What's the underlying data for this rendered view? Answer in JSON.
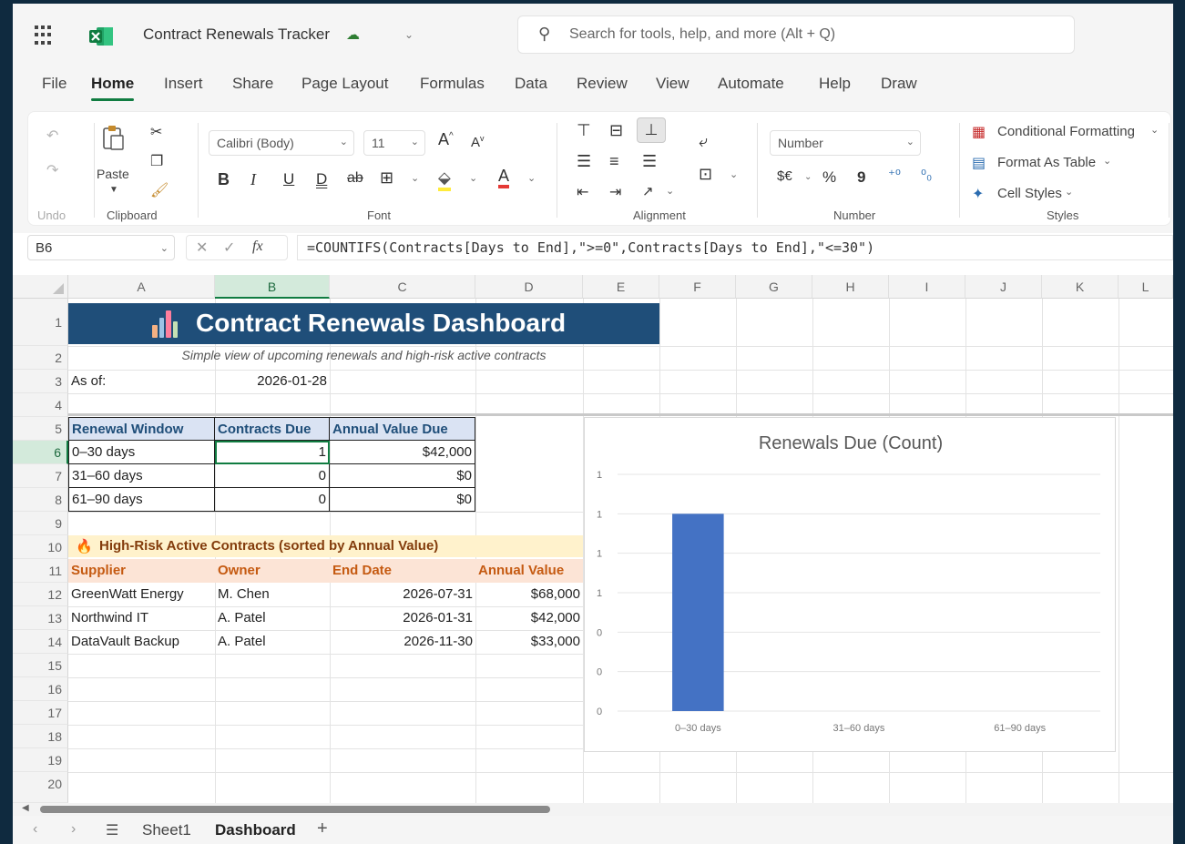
{
  "titlebar": {
    "doc_title": "Contract Renewals Tracker",
    "search_placeholder": "Search for tools, help, and more (Alt + Q)"
  },
  "menu": {
    "tabs": [
      "File",
      "Home",
      "Insert",
      "Share",
      "Page Layout",
      "Formulas",
      "Data",
      "Review",
      "View",
      "Automate",
      "Help",
      "Draw"
    ],
    "active": "Home"
  },
  "ribbon": {
    "undo_label": "Undo",
    "paste_label": "Paste",
    "clipboard_label": "Clipboard",
    "font_name": "Calibri (Body)",
    "font_size": "11",
    "font_label": "Font",
    "bold": "B",
    "italic": "I",
    "underline": "U",
    "alignment_label": "Alignment",
    "number_format": "Number",
    "number_label": "Number",
    "currency": "$€",
    "percent": "%",
    "comma": "9",
    "conditional_formatting": "Conditional Formatting",
    "format_as_table": "Format As Table",
    "cell_styles": "Cell Styles",
    "styles_label": "Styles"
  },
  "formula_bar": {
    "name_box": "B6",
    "formula": "=COUNTIFS(Contracts[Days to End],\">=0\",Contracts[Days to End],\"<=30\")"
  },
  "columns": [
    "A",
    "B",
    "C",
    "D",
    "E",
    "F",
    "G",
    "H",
    "I",
    "J",
    "K",
    "L"
  ],
  "selected_column": "B",
  "rows": [
    "1",
    "2",
    "3",
    "4",
    "5",
    "6",
    "7",
    "8",
    "9",
    "10",
    "11",
    "12",
    "13",
    "14",
    "15",
    "16",
    "17",
    "18",
    "19",
    "20"
  ],
  "selected_row": "6",
  "sheet": {
    "title": "Contract Renewals Dashboard",
    "subtitle": "Simple view of upcoming renewals and high-risk active contracts",
    "as_of_label": "As of:",
    "as_of_value": "2026-01-28",
    "renewal_table": {
      "headers": [
        "Renewal Window",
        "Contracts Due",
        "Annual Value Due"
      ],
      "rows": [
        [
          "0–30 days",
          "1",
          "$42,000"
        ],
        [
          "31–60 days",
          "0",
          "$0"
        ],
        [
          "61–90 days",
          "0",
          "$0"
        ]
      ]
    },
    "risk_title": "High-Risk Active Contracts (sorted by Annual Value)",
    "risk_table": {
      "headers": [
        "Supplier",
        "Owner",
        "End Date",
        "Annual Value"
      ],
      "rows": [
        [
          "GreenWatt Energy",
          "M. Chen",
          "2026-07-31",
          "$68,000"
        ],
        [
          "Northwind IT",
          "A. Patel",
          "2026-01-31",
          "$42,000"
        ],
        [
          "DataVault Backup",
          "A. Patel",
          "2026-11-30",
          "$33,000"
        ]
      ]
    }
  },
  "chart_data": {
    "type": "bar",
    "title": "Renewals Due (Count)",
    "categories": [
      "0–30 days",
      "31–60 days",
      "61–90 days"
    ],
    "values": [
      1,
      0,
      0
    ],
    "ytick_labels": [
      "1",
      "1",
      "1",
      "1",
      "0",
      "0",
      "0"
    ],
    "ylim": [
      0,
      1.2
    ],
    "grid": true,
    "bar_color": "#4472c4"
  },
  "sheets": {
    "tabs": [
      "Sheet1",
      "Dashboard"
    ],
    "active": "Dashboard",
    "add": "+"
  },
  "colors": {
    "accent": "#107c41",
    "banner": "#1f4e79",
    "table_header": "#dae3f3",
    "risk_banner": "#fff2cc",
    "risk_header": "#fce4d6"
  }
}
